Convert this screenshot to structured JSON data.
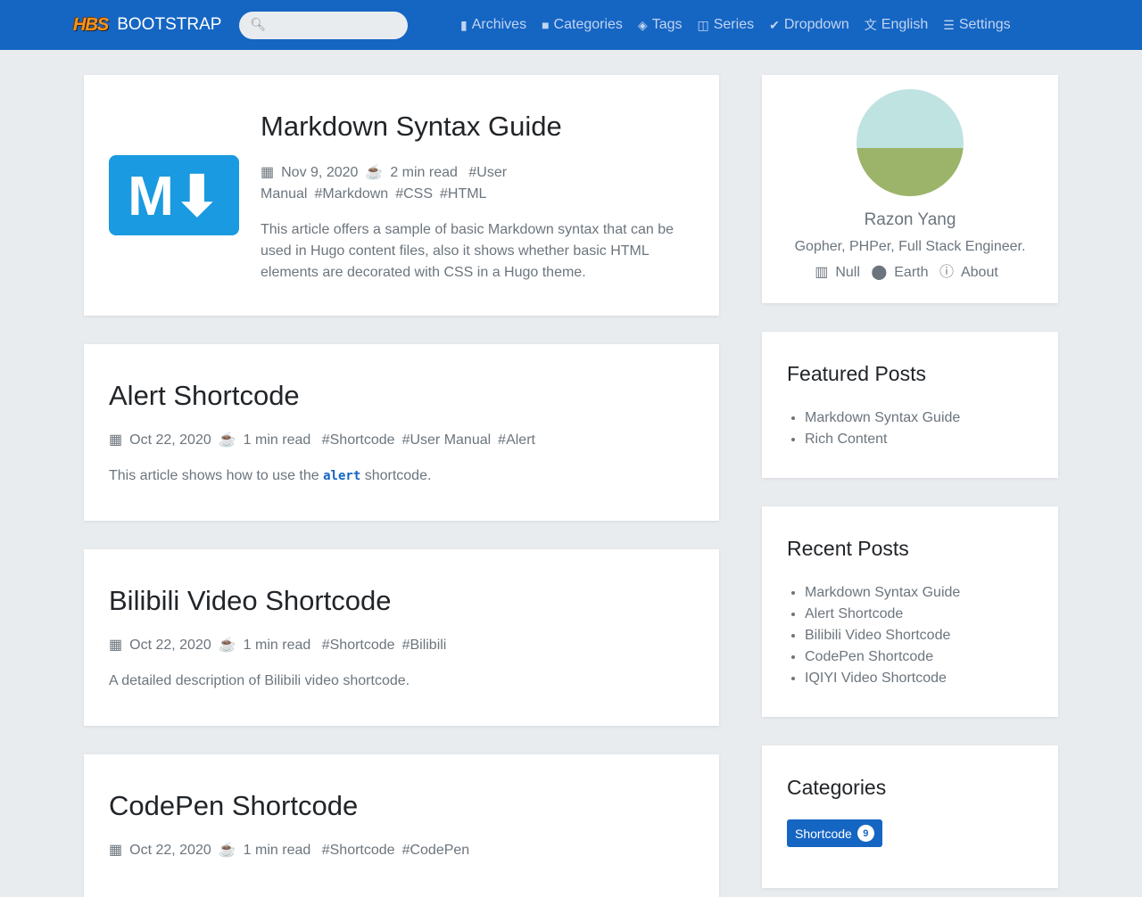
{
  "nav": {
    "logo": "HBS",
    "brand": "BOOTSTRAP",
    "search_placeholder": "",
    "items": [
      {
        "icon": "file-archive-icon",
        "glyph": "▮",
        "label": "Archives"
      },
      {
        "icon": "folder-icon",
        "glyph": "■",
        "label": "Categories"
      },
      {
        "icon": "tags-icon",
        "glyph": "◈",
        "label": "Tags"
      },
      {
        "icon": "columns-icon",
        "glyph": "◫",
        "label": "Series"
      },
      {
        "icon": "check-circle-icon",
        "glyph": "✔",
        "label": "Dropdown"
      },
      {
        "icon": "language-icon",
        "glyph": "文",
        "label": "English"
      },
      {
        "icon": "sliders-icon",
        "glyph": "☰",
        "label": "Settings"
      }
    ]
  },
  "posts": [
    {
      "title": "Markdown Syntax Guide",
      "date": "Nov 9, 2020",
      "read": "2 min read",
      "tags": [
        "#User Manual",
        "#Markdown",
        "#CSS",
        "#HTML"
      ],
      "desc": "This article offers a sample of basic Markdown syntax that can be used in Hugo content files, also it shows whether basic HTML elements are decorated with CSS in a Hugo theme."
    },
    {
      "title": "Alert Shortcode",
      "date": "Oct 22, 2020",
      "read": "1 min read",
      "tags": [
        "#Shortcode",
        "#User Manual",
        "#Alert"
      ],
      "desc_pre": "This article shows how to use the ",
      "desc_code": "alert",
      "desc_post": " shortcode."
    },
    {
      "title": "Bilibili Video Shortcode",
      "date": "Oct 22, 2020",
      "read": "1 min read",
      "tags": [
        "#Shortcode",
        "#Bilibili"
      ],
      "desc": "A detailed description of Bilibili video shortcode."
    },
    {
      "title": "CodePen Shortcode",
      "date": "Oct 22, 2020",
      "read": "1 min read",
      "tags": [
        "#Shortcode",
        "#CodePen"
      ]
    }
  ],
  "profile": {
    "name": "Razon Yang",
    "bio": "Gopher, PHPer, Full Stack Engineer.",
    "company": "Null",
    "location": "Earth",
    "about": "About"
  },
  "featured": {
    "title": "Featured Posts",
    "items": [
      "Markdown Syntax Guide",
      "Rich Content"
    ]
  },
  "recent": {
    "title": "Recent Posts",
    "items": [
      "Markdown Syntax Guide",
      "Alert Shortcode",
      "Bilibili Video Shortcode",
      "CodePen Shortcode",
      "IQIYI Video Shortcode"
    ]
  },
  "categories": {
    "title": "Categories",
    "items": [
      {
        "label": "Shortcode",
        "count": "9"
      }
    ]
  }
}
